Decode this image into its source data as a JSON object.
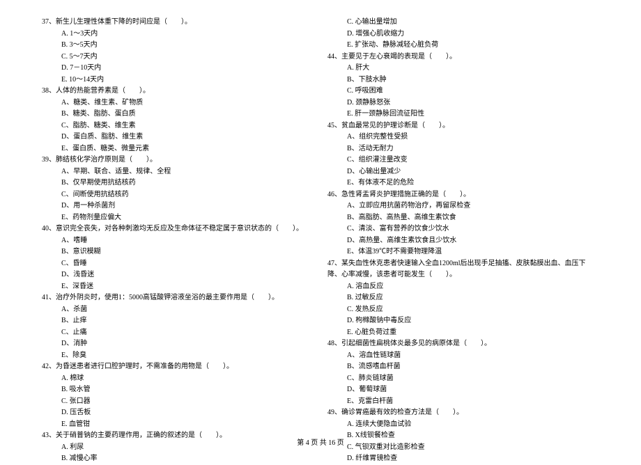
{
  "leftColumn": [
    {
      "q": "37、新生儿生理性体重下降的时间应是（　　）。",
      "opts": [
        "A. 1～3天内",
        "B. 3～5天内",
        "C. 5～7天内",
        "D. 7－10天内",
        "E. 10～14天内"
      ]
    },
    {
      "q": "38、人体的热能营养素是（　　）。",
      "opts": [
        "A、糖类、维生素、矿物质",
        "B、糖类、脂肪、蛋白质",
        "C、脂肪、糖类、维生素",
        "D、蛋白质、脂肪、维生素",
        "E、蛋白质、糖类、微量元素"
      ]
    },
    {
      "q": "39、肺结核化学治疗原则是（　　）。",
      "opts": [
        "A、早期、联合、适量、规律、全程",
        "B、仅早期使用抗结核药",
        "C、间断使用抗结核药",
        "D、用一种杀菌剂",
        "E、药物剂量应偏大"
      ]
    },
    {
      "q": "40、意识完全丧失，对各种刺激均无反应及生命体征不稳定属于意识状态的（　　）。",
      "opts": [
        "A、嗜睡",
        "B、意识模糊",
        "C、昏睡",
        "D、浅昏迷",
        "E、深昏迷"
      ]
    },
    {
      "q": "41、治疗外阴炎时，使用1：5000高锰酸钾溶液坐浴的最主要作用是（　　）。",
      "opts": [
        "A、杀菌",
        "B、止痒",
        "C、止痛",
        "D、消肿",
        "E、除臭"
      ]
    },
    {
      "q": "42、为昏迷患者进行口腔护理时，不需准备的用物是（　　）。",
      "opts": [
        "A. 棉球",
        "B. 吸水管",
        "C. 张口器",
        "D. 压舌板",
        "E. 血管钳"
      ]
    },
    {
      "q": "43、关于硝普钠的主要药理作用，正确的叙述的是（　　）。",
      "opts": [
        "A. 利尿",
        "B. 减慢心率"
      ]
    }
  ],
  "rightColumn": [
    {
      "q": null,
      "opts": [
        "C. 心输出量增加",
        "D. 增强心肌收缩力",
        "E. 扩张动、静脉减轻心脏负荷"
      ]
    },
    {
      "q": "44、主要见于左心衰竭的表现是（　　）。",
      "opts": [
        "A. 肝大",
        "B、下肢水肿",
        "C. 呼吸困难",
        "D. 颈静脉怒张",
        "E. 肝一颈静脉回流征阳性"
      ]
    },
    {
      "q": "45、贫血最常见的护理诊断是（　　）。",
      "opts": [
        "A、组织完整性受损",
        "B、活动无耐力",
        "C、组织灌注量改变",
        "D、心输出量减少",
        "E、有体液不足的危险"
      ]
    },
    {
      "q": "46、急性肾盂肾炎护理措施正确的是（　　）。",
      "opts": [
        "A、立即应用抗菌药物治疗，再留尿检查",
        "B、高脂肪、高热量、高维生素饮食",
        "C、清淡、富有营养的饮食少饮水",
        "D、高热量、高维生素饮食且少饮水",
        "E、体温39℃时不需要物理降温"
      ]
    },
    {
      "q": "47、某失血性休克患者快速输入全血1200ml后出现手足抽搐、皮肤黏膜出血、血压下降、心率减慢，该患者可能发生（　　）。",
      "opts": [
        "A. 溶血反应",
        "B. 过敏反应",
        "C. 发热反应",
        "D. 枸橼酸钠中毒反应",
        "E. 心脏负荷过重"
      ]
    },
    {
      "q": "48、引起细菌性扁桃体炎最多见的病原体是（　　）。",
      "opts": [
        "A、溶血性链球菌",
        "B、流感嗜血杆菌",
        "C、肺炎链球菌",
        "D、葡萄球菌",
        "E、克雷白杆菌"
      ]
    },
    {
      "q": "49、确诊胃癌最有效的检查方法是（　　）。",
      "opts": [
        "A. 连续大便隐血试验",
        "B. X线钡餐检查",
        "C. 气钡双重对比造影检查",
        "D. 纤维胃镜检查"
      ]
    }
  ],
  "footer": "第 4 页 共 16 页"
}
